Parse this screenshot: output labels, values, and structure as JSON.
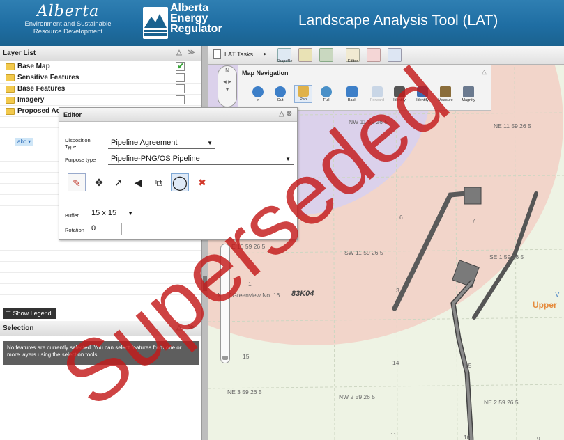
{
  "header": {
    "gov_logo_text": "Alberta",
    "gov_subtitle_1": "Environment and Sustainable",
    "gov_subtitle_2": "Resource Development",
    "regulator_line1": "Alberta",
    "regulator_line2": "Energy",
    "regulator_line3": "Regulator",
    "app_title": "Landscape Analysis Tool (LAT)"
  },
  "layer_list": {
    "title": "Layer List",
    "controls": "△ ≫",
    "items": [
      {
        "label": "Base Map",
        "checked": true
      },
      {
        "label": "Sensitive Features",
        "checked": false
      },
      {
        "label": "Base Features",
        "checked": false
      },
      {
        "label": "Imagery",
        "checked": false
      },
      {
        "label": "Proposed Ac",
        "checked": false
      }
    ],
    "sub_item": "abc ▾",
    "legend_button": "Show Legend"
  },
  "selection": {
    "title": "Selection",
    "controls": "△ ≫",
    "message": "No features are currently selected. You can select features from one or more layers using the selection tools."
  },
  "lat_toolbar": {
    "tasks_label": "LAT Tasks",
    "arrow": "▸",
    "shapefile_label": "Shapefile",
    "editor_label": "Editor"
  },
  "map_navigation": {
    "title": "Map Navigation",
    "control": "△",
    "tools": [
      {
        "label": "In",
        "color": "#3d7fc8"
      },
      {
        "label": "Out",
        "color": "#3d7fc8"
      },
      {
        "label": "Pan",
        "color": "#e0b24a"
      },
      {
        "label": "Full",
        "color": "#4a90c8"
      },
      {
        "label": "Back",
        "color": "#3d7fc8"
      },
      {
        "label": "Forward",
        "color": "#c9d6e6"
      },
      {
        "label": "Identify",
        "color": "#555555"
      },
      {
        "label": "Identify",
        "color": "#3d6cb0"
      },
      {
        "label": "Measure",
        "color": "#8a6d3b"
      },
      {
        "label": "Magnify",
        "color": "#6b7a8f"
      }
    ]
  },
  "compass": {
    "label_n": "N"
  },
  "editor": {
    "title": "Editor",
    "controls": "△ ⊗",
    "disposition_label_1": "Disposition",
    "disposition_label_2": "Type",
    "disposition_value": "Pipeline Agreement",
    "purpose_label": "Purpose type",
    "purpose_value": "Pipeline-PNG/OS Pipeline",
    "buffer_label": "Buffer",
    "buffer_value": "15 x 15",
    "rotation_label": "Rotation",
    "rotation_value": "0",
    "tools": [
      {
        "name": "draw-pencil",
        "glyph": "✎",
        "color": "#c0392b"
      },
      {
        "name": "move",
        "glyph": "✥",
        "color": "#222222"
      },
      {
        "name": "add-vertex",
        "glyph": "➚",
        "color": "#222222"
      },
      {
        "name": "reshape",
        "glyph": "◀",
        "color": "#222222"
      },
      {
        "name": "cut",
        "glyph": "⧉",
        "color": "#222222"
      },
      {
        "name": "rotate",
        "glyph": "◯",
        "color": "#222222"
      },
      {
        "name": "delete",
        "glyph": "✖",
        "color": "#d33a2c"
      }
    ]
  },
  "map_labels": [
    {
      "text": "NW 11 59 26 5",
      "cls": ""
    },
    {
      "text": "NE 11 59 26 5",
      "cls": ""
    },
    {
      "text": "E 10 59 26 5",
      "cls": ""
    },
    {
      "text": "SW 11 59 26 5",
      "cls": ""
    },
    {
      "text": "SE 1 59 26 5",
      "cls": ""
    },
    {
      "text": "6",
      "cls": ""
    },
    {
      "text": "7",
      "cls": ""
    },
    {
      "text": "1",
      "cls": ""
    },
    {
      "text": "3",
      "cls": ""
    },
    {
      "text": "M.  of Greenview No. 16",
      "cls": ""
    },
    {
      "text": "83K04",
      "cls": "dark"
    },
    {
      "text": "Upper",
      "cls": "orange"
    },
    {
      "text": "V",
      "cls": ""
    },
    {
      "text": "15",
      "cls": ""
    },
    {
      "text": "14",
      "cls": ""
    },
    {
      "text": "15",
      "cls": ""
    },
    {
      "text": "NE 3 59 26 5",
      "cls": ""
    },
    {
      "text": "NW 2 59 26 5",
      "cls": ""
    },
    {
      "text": "NE 2 59 26 5",
      "cls": ""
    },
    {
      "text": "11",
      "cls": ""
    },
    {
      "text": "10",
      "cls": ""
    },
    {
      "text": "9",
      "cls": ""
    }
  ],
  "watermark": {
    "text": "Superseded",
    "color": "#c41a1a"
  }
}
